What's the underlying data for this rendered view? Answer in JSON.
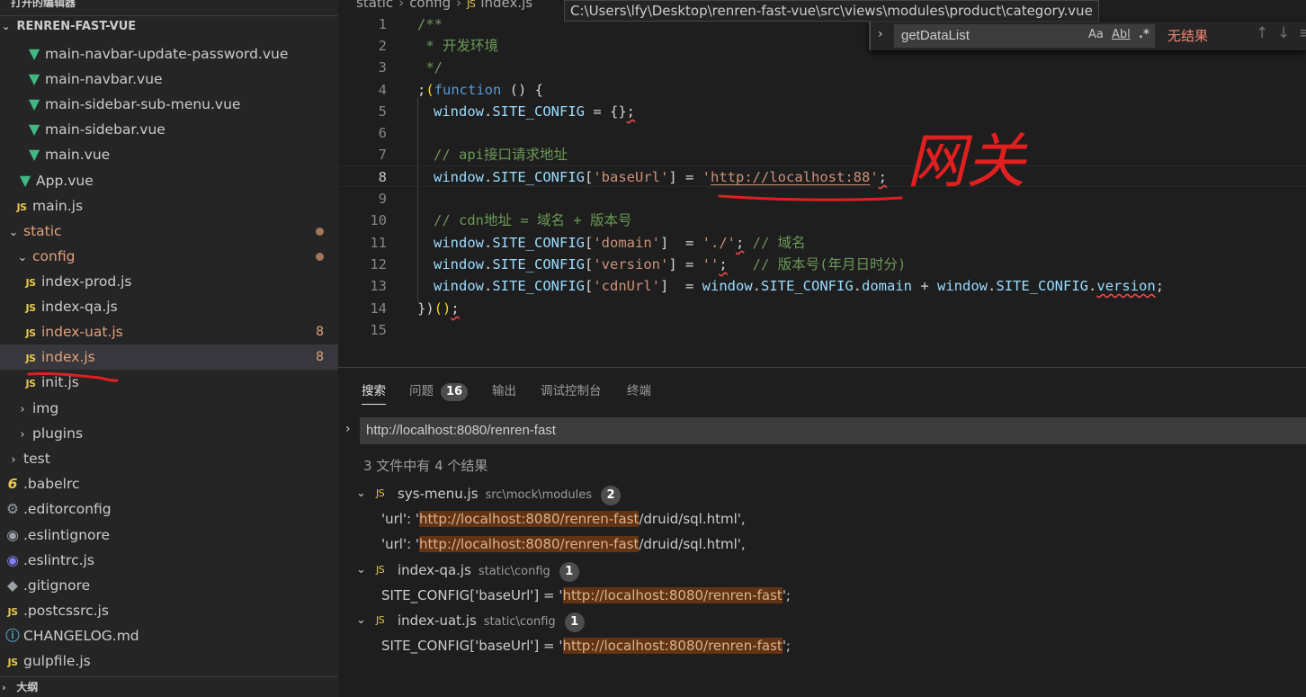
{
  "sidebar": {
    "top_title": "打开的编辑器",
    "section_title": "RENREN-FAST-VUE",
    "bottom_title": "大纲",
    "items": [
      {
        "label": "main-navbar-update-password.vue",
        "icon": "vue-icon"
      },
      {
        "label": "main-navbar.vue",
        "icon": "vue-icon"
      },
      {
        "label": "main-sidebar-sub-menu.vue",
        "icon": "vue-icon"
      },
      {
        "label": "main-sidebar.vue",
        "icon": "vue-icon"
      },
      {
        "label": "main.vue",
        "icon": "vue-icon"
      },
      {
        "label": "App.vue",
        "icon": "vue-icon"
      },
      {
        "label": "main.js",
        "icon": "js-icon"
      },
      {
        "label": "static",
        "icon": "chevron-down-icon"
      },
      {
        "label": "config",
        "icon": "chevron-down-icon"
      },
      {
        "label": "index-prod.js",
        "icon": "js-icon"
      },
      {
        "label": "index-qa.js",
        "icon": "js-icon"
      },
      {
        "label": "index-uat.js",
        "icon": "js-icon",
        "count": "8"
      },
      {
        "label": "index.js",
        "icon": "js-icon",
        "count": "8"
      },
      {
        "label": "init.js",
        "icon": "js-icon"
      },
      {
        "label": "img",
        "icon": "chevron-right-icon"
      },
      {
        "label": "plugins",
        "icon": "chevron-right-icon"
      },
      {
        "label": "test",
        "icon": "chevron-right-icon"
      },
      {
        "label": ".babelrc",
        "icon": "babel-icon"
      },
      {
        "label": ".editorconfig",
        "icon": "gear-icon"
      },
      {
        "label": ".eslintignore",
        "icon": "eslint-icon"
      },
      {
        "label": ".eslintrc.js",
        "icon": "eslint-icon"
      },
      {
        "label": ".gitignore",
        "icon": "git-icon"
      },
      {
        "label": ".postcssrc.js",
        "icon": "js-icon"
      },
      {
        "label": "CHANGELOG.md",
        "icon": "info-icon"
      },
      {
        "label": "gulpfile.js",
        "icon": "js-icon"
      }
    ]
  },
  "editor": {
    "breadcrumb": [
      "static",
      "config",
      "index.js"
    ],
    "js_badge": "JS",
    "tooltip": "C:\\Users\\lfy\\Desktop\\renren-fast-vue\\src\\views\\modules\\product\\category.vue",
    "find": {
      "value": "getDataList",
      "opt_case": "Aa",
      "opt_word": "Abl",
      "opt_regex": ".*",
      "no_result": "无结果"
    },
    "line_numbers": [
      "1",
      "2",
      "3",
      "4",
      "5",
      "6",
      "7",
      "8",
      "9",
      "10",
      "11",
      "12",
      "13",
      "14",
      "15"
    ],
    "annotation": "网关"
  },
  "panel": {
    "tabs": {
      "search": "搜索",
      "problems": "问题",
      "problems_count": "16",
      "output": "输出",
      "debug_console": "调试控制台",
      "terminal": "终端"
    },
    "search_value": "http://localhost:8080/renren-fast",
    "summary": "3 文件中有 4 个结果",
    "results": [
      {
        "file": "sys-menu.js",
        "path": "src\\mock\\modules",
        "count": "2",
        "matches": [
          {
            "pre": "'url': '",
            "hit": "http://localhost:8080/renren-fast",
            "post": "/druid/sql.html',"
          },
          {
            "pre": "'url': '",
            "hit": "http://localhost:8080/renren-fast",
            "post": "/druid/sql.html',"
          }
        ]
      },
      {
        "file": "index-qa.js",
        "path": "static\\config",
        "count": "1",
        "matches": [
          {
            "pre": "SITE_CONFIG['baseUrl'] = '",
            "hit": "http://localhost:8080/renren-fast",
            "post": "';"
          }
        ]
      },
      {
        "file": "index-uat.js",
        "path": "static\\config",
        "count": "1",
        "matches": [
          {
            "pre": "SITE_CONFIG['baseUrl'] = '",
            "hit": "http://localhost:8080/renren-fast",
            "post": "';"
          }
        ]
      }
    ]
  },
  "colors": {
    "editor_bg": "#1e1e1e",
    "sidebar_bg": "#252526",
    "vue": "#41b883",
    "js": "#e8c94b",
    "modified": "#e2a27a",
    "highlight": "#623315",
    "annotation": "#e02020"
  }
}
